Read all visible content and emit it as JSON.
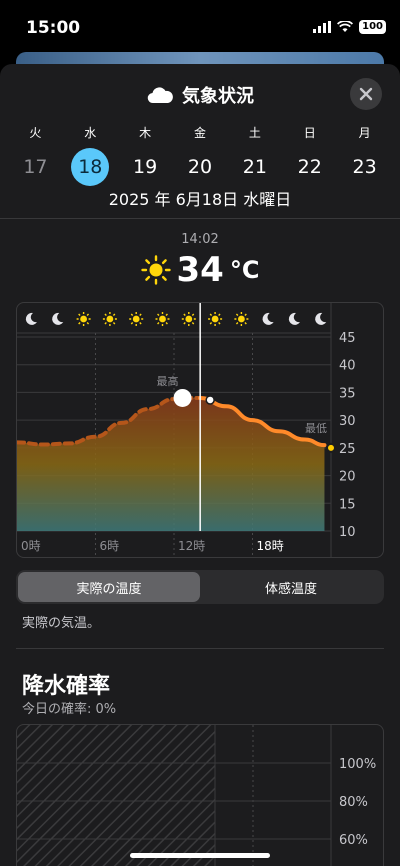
{
  "status": {
    "time": "15:00",
    "battery": "100"
  },
  "sheet": {
    "title": "気象状況",
    "title_icon": "cloud-icon",
    "close_icon": "close-icon"
  },
  "days": [
    {
      "dow": "火",
      "num": "17"
    },
    {
      "dow": "水",
      "num": "18"
    },
    {
      "dow": "木",
      "num": "19"
    },
    {
      "dow": "金",
      "num": "20"
    },
    {
      "dow": "土",
      "num": "21"
    },
    {
      "dow": "日",
      "num": "22"
    },
    {
      "dow": "月",
      "num": "23"
    }
  ],
  "selected_date": "2025 年 6月18日 水曜日",
  "current": {
    "time": "14:02",
    "temp": "34",
    "unit": "°C",
    "icon": "sun-icon"
  },
  "chart_data": {
    "type": "line",
    "x": [
      "0時",
      "6時",
      "12時",
      "18時"
    ],
    "hour_icons": [
      "moon-icon",
      "moon-icon",
      "sun-icon",
      "sun-icon",
      "sun-icon",
      "sun-icon",
      "sun-icon",
      "sun-icon",
      "sun-icon",
      "moon-icon",
      "moon-icon",
      "moon-icon"
    ],
    "y_ticks": [
      "45",
      "40",
      "35",
      "30",
      "25",
      "20",
      "15",
      "10"
    ],
    "ylim": [
      10,
      45
    ],
    "series": [
      {
        "hours": [
          0,
          2,
          4,
          6,
          8,
          10,
          12,
          13,
          14,
          16,
          18,
          20,
          22,
          23.5
        ],
        "values": [
          26,
          25.6,
          25.8,
          27,
          29.5,
          32,
          33.8,
          34,
          34,
          32.5,
          30,
          28,
          26.5,
          25.5
        ]
      }
    ],
    "current_hour": 14,
    "labels": {
      "max": "最高",
      "min": "最低"
    }
  },
  "segment": {
    "options": [
      "実際の温度",
      "体感温度"
    ],
    "selected": 0
  },
  "segment_desc": "実際の気温。",
  "precip": {
    "title": "降水確率",
    "subtitle": "今日の確率: 0%",
    "y_ticks": [
      "100%",
      "80%",
      "60%"
    ]
  },
  "colors": {
    "accent": "#5ac8fa",
    "line": "#ff8a2a"
  }
}
